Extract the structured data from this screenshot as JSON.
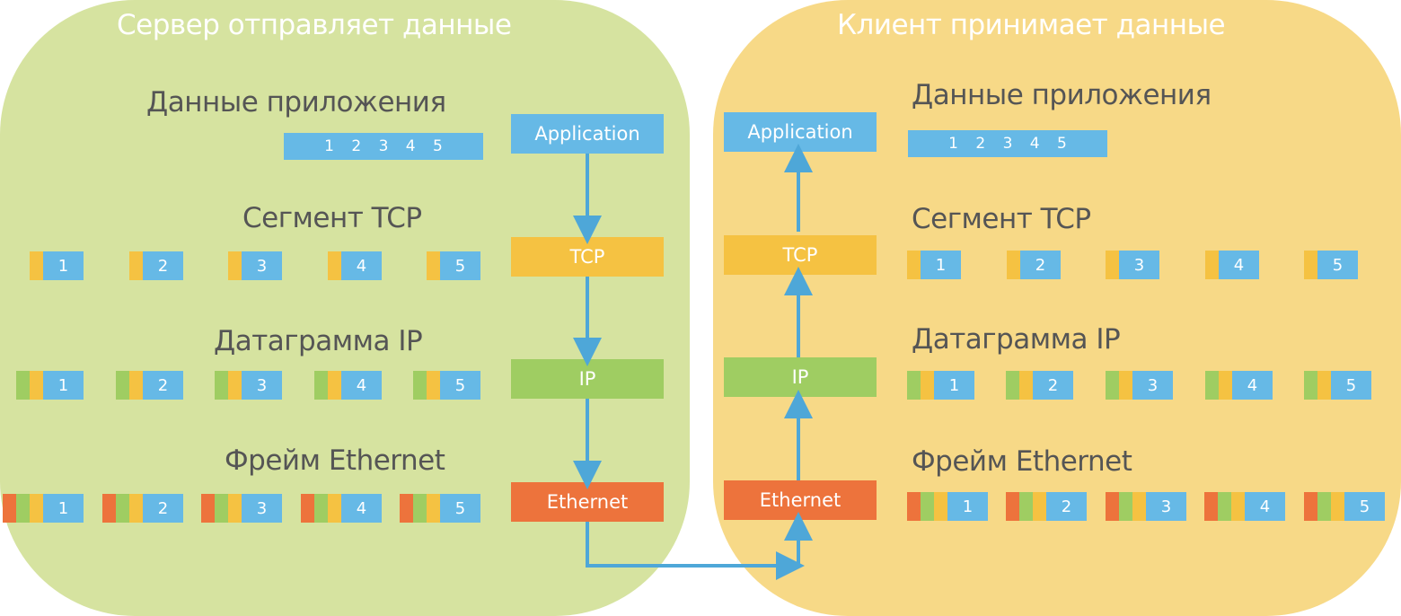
{
  "colors": {
    "application": "#66b9e6",
    "tcp": "#f5c242",
    "ip": "#9fcd62",
    "ethernet": "#ed733c",
    "server_bg": "#d6e3a0",
    "client_bg": "#f7d987",
    "arrow": "#4ea7d8"
  },
  "server": {
    "title": "Сервер отправляет данные",
    "headings": {
      "app": "Данные приложения",
      "tcp": "Сегмент TCP",
      "ip": "Датаграмма IP",
      "eth": "Фрейм Ethernet"
    },
    "app_data": "1 2 3 4 5",
    "segments": [
      "1",
      "2",
      "3",
      "4",
      "5"
    ],
    "layers": [
      "Application",
      "TCP",
      "IP",
      "Ethernet"
    ]
  },
  "client": {
    "title": "Клиент принимает данные",
    "headings": {
      "app": "Данные приложения",
      "tcp": "Сегмент TCP",
      "ip": "Датаграмма IP",
      "eth": "Фрейм Ethernet"
    },
    "app_data": "1 2 3 4 5",
    "segments": [
      "1",
      "2",
      "3",
      "4",
      "5"
    ],
    "layers": [
      "Application",
      "TCP",
      "IP",
      "Ethernet"
    ]
  }
}
